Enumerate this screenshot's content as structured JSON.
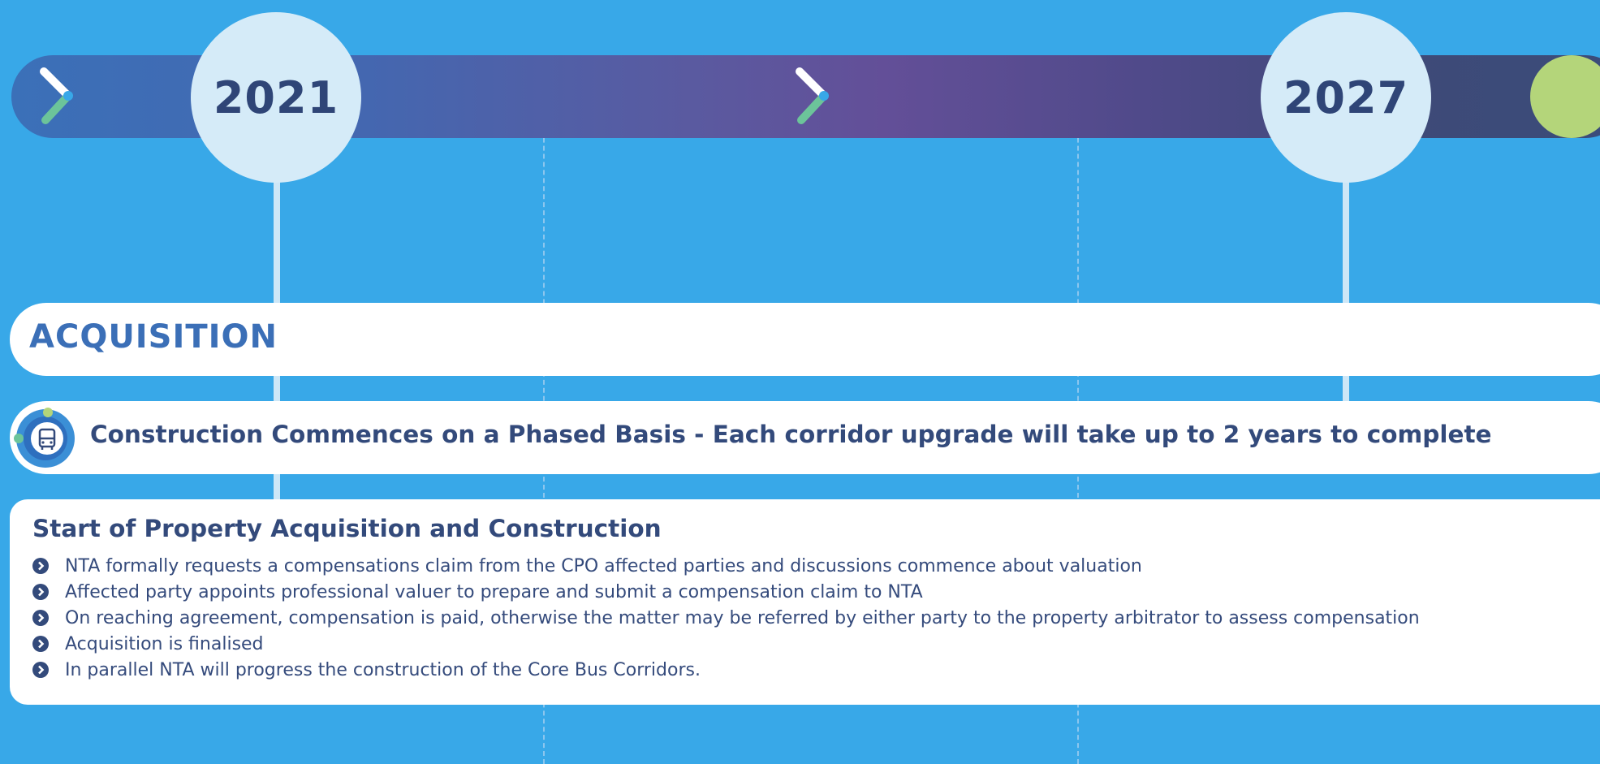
{
  "timeline": {
    "years": [
      "2021",
      "2027"
    ],
    "colors": {
      "background": "#38a8e8",
      "accent_green": "#b4d57a",
      "navy": "#334a7b",
      "blue_title": "#3b6fb7"
    }
  },
  "acquisition": {
    "title": "ACQUISITION"
  },
  "construction": {
    "title": "Construction Commences on a Phased Basis - Each corridor upgrade will take up to 2 years to complete",
    "icon": "bus-icon"
  },
  "details": {
    "title": "Start of Property Acquisition and Construction",
    "bullets": [
      "NTA formally requests a compensations claim from the CPO affected parties and discussions commence about valuation",
      "Affected party appoints professional valuer to prepare and submit a compensation claim to NTA",
      "On reaching agreement, compensation is paid, otherwise the matter may be referred by either party to the property arbitrator to assess compensation",
      "Acquisition is finalised",
      "In parallel NTA will progress the construction of the Core Bus Corridors."
    ]
  }
}
